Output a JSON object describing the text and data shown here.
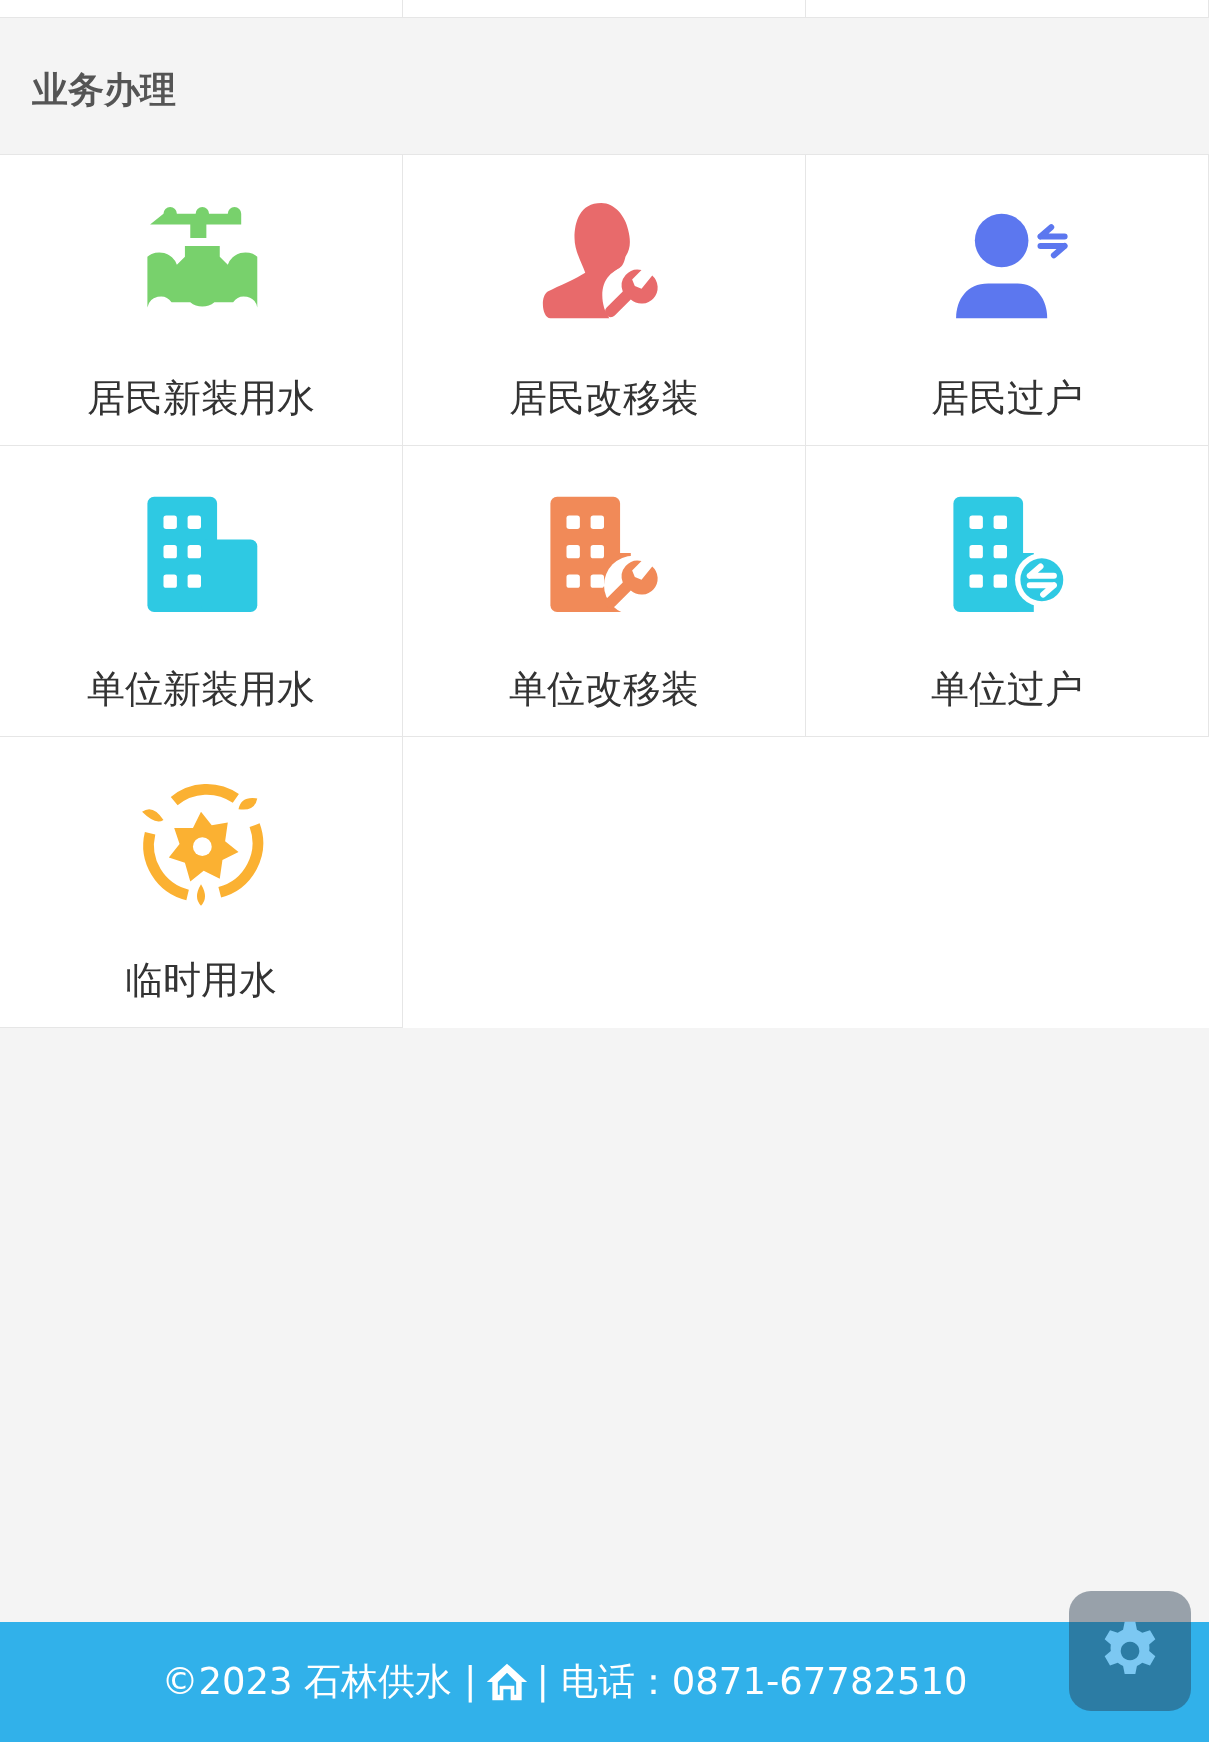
{
  "section": {
    "title": "业务办理"
  },
  "services": [
    {
      "label": "居民新装用水",
      "kind": "tap",
      "color": "#78d16c"
    },
    {
      "label": "居民改移装",
      "kind": "person-wrench",
      "color": "#e86a6b"
    },
    {
      "label": "居民过户",
      "kind": "person-transfer",
      "color": "#5c77ef"
    },
    {
      "label": "单位新装用水",
      "kind": "building",
      "color": "#2ec9e3"
    },
    {
      "label": "单位改移装",
      "kind": "building-wrench",
      "color": "#f18a58"
    },
    {
      "label": "单位过户",
      "kind": "building-transfer",
      "color": "#2ec9e3"
    },
    {
      "label": "临时用水",
      "kind": "turbine",
      "color": "#fbb132"
    }
  ],
  "footer": {
    "copyright": "©2023 石林供水 |",
    "contact": "| 电话：0871-67782510"
  }
}
